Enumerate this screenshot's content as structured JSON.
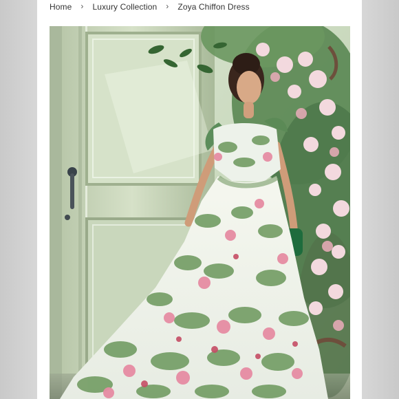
{
  "breadcrumb": {
    "items": [
      {
        "label": "Home"
      },
      {
        "label": "Luxury Collection"
      },
      {
        "label": "Zoya Chiffon Dress"
      }
    ],
    "separator_icon": "chevron-right-icon"
  },
  "product": {
    "image_icon": "product-photo",
    "colors": {
      "door": "#b8c8a8",
      "wall": "#e8eee4",
      "dress_base": "#f2f4ee",
      "accent_pink": "#e98aa4",
      "leaf_green": "#3e7a3f"
    }
  }
}
